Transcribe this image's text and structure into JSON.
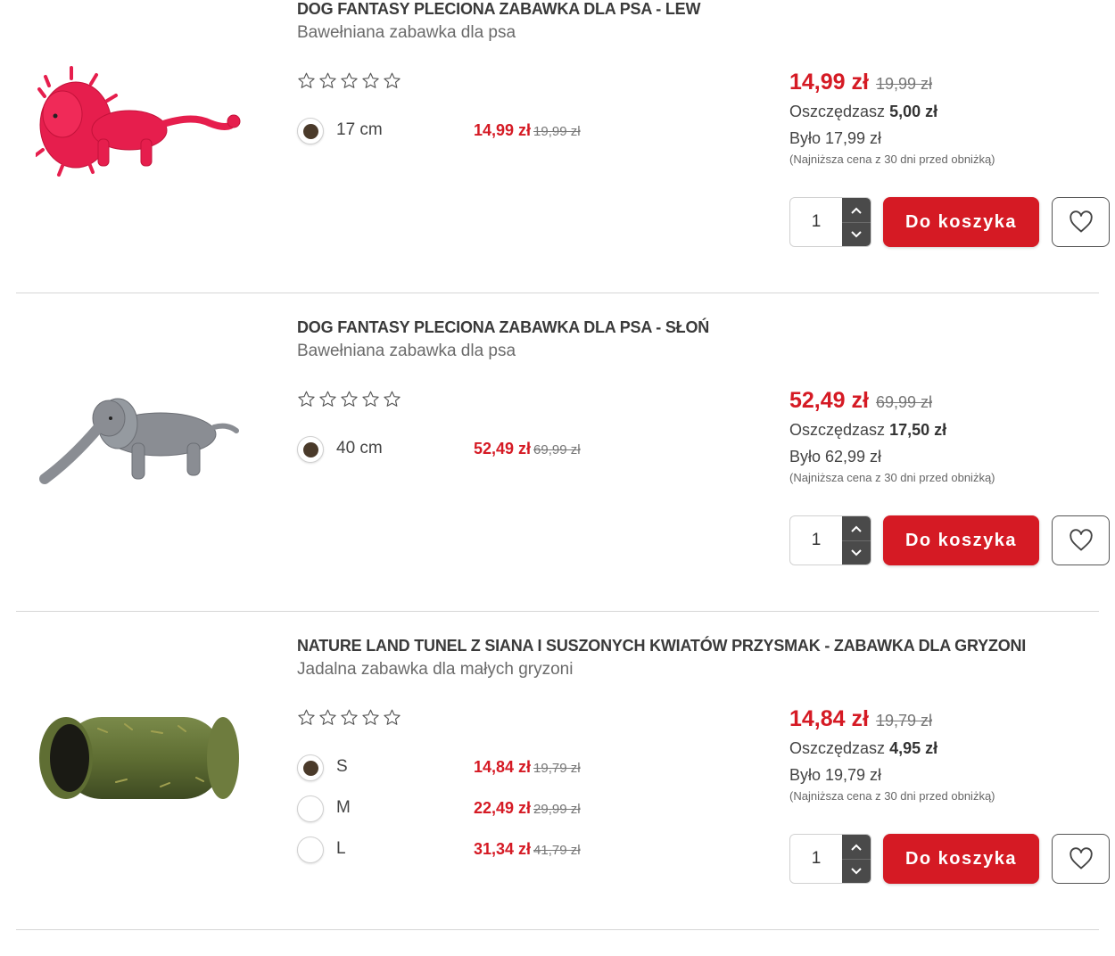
{
  "products": [
    {
      "title": "DOG FANTASY PLECIONA ZABAWKA DLA PSA - LEW",
      "subtitle": "Bawełniana zabawka dla psa",
      "image": "red-rope-lion-toy",
      "rating": 0,
      "price": "14,99 zł",
      "old_price": "19,99 zł",
      "savings_label": "Oszczędzasz",
      "savings": "5,00 zł",
      "was": "Było 17,99 zł",
      "lowest_note": "(Najniższa cena z 30 dni przed obniżką)",
      "quantity": "1",
      "cart_label": "Do koszyka",
      "variants": [
        {
          "label": "17 cm",
          "price": "14,99 zł",
          "old_price": "19,99 zł",
          "selected": true
        }
      ]
    },
    {
      "title": "DOG FANTASY PLECIONA ZABAWKA DLA PSA - SŁOŃ",
      "subtitle": "Bawełniana zabawka dla psa",
      "image": "grey-rope-elephant-toy",
      "rating": 0,
      "price": "52,49 zł",
      "old_price": "69,99 zł",
      "savings_label": "Oszczędzasz",
      "savings": "17,50 zł",
      "was": "Było 62,99 zł",
      "lowest_note": "(Najniższa cena z 30 dni przed obniżką)",
      "quantity": "1",
      "cart_label": "Do koszyka",
      "variants": [
        {
          "label": "40 cm",
          "price": "52,49 zł",
          "old_price": "69,99 zł",
          "selected": true
        }
      ]
    },
    {
      "title": "NATURE LAND TUNEL Z SIANA I SUSZONYCH KWIATÓW PRZYSMAK - ZABAWKA DLA GRYZONI",
      "subtitle": "Jadalna zabawka dla małych gryzoni",
      "image": "hay-tunnel-toy",
      "rating": 0,
      "price": "14,84 zł",
      "old_price": "19,79 zł",
      "savings_label": "Oszczędzasz",
      "savings": "4,95 zł",
      "was": "Było 19,79 zł",
      "lowest_note": "(Najniższa cena z 30 dni przed obniżką)",
      "quantity": "1",
      "cart_label": "Do koszyka",
      "variants": [
        {
          "label": "S",
          "price": "14,84 zł",
          "old_price": "19,79 zł",
          "selected": true
        },
        {
          "label": "M",
          "price": "22,49 zł",
          "old_price": "29,99 zł",
          "selected": false
        },
        {
          "label": "L",
          "price": "31,34 zł",
          "old_price": "41,79 zł",
          "selected": false
        }
      ]
    }
  ],
  "colors": {
    "accent": "#d51a24",
    "radio_fill": "#4a3a2a",
    "stepper": "#4a4a4a"
  },
  "icons": {
    "star": "star-outline-icon",
    "wishlist": "heart-outline-icon",
    "qty_up": "chevron-up-icon",
    "qty_down": "chevron-down-icon"
  }
}
